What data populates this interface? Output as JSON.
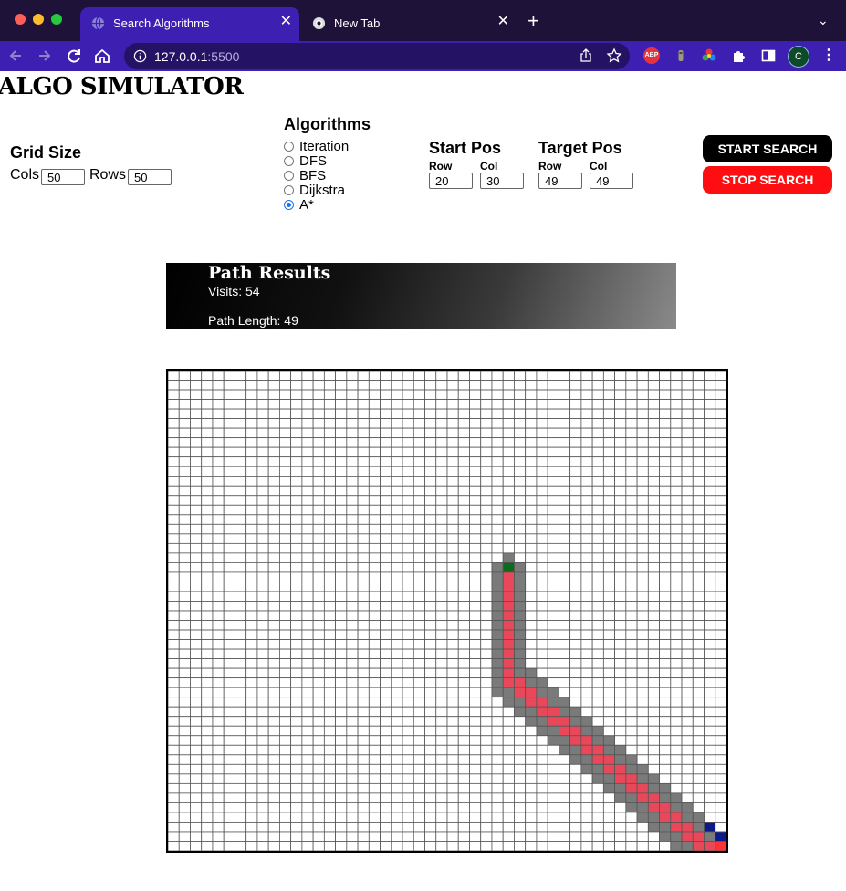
{
  "browser": {
    "tabs": [
      {
        "title": "Search Algorithms",
        "active": true,
        "icon": "globe-icon"
      },
      {
        "title": "New Tab",
        "active": false,
        "icon": "chrome-icon"
      }
    ],
    "close_glyph": "✕",
    "new_tab_glyph": "+",
    "tab_menu_glyph": "⌄",
    "url_host": "127.0.0.1",
    "url_port": ":5500",
    "extension_abp_label": "ABP",
    "profile_initial": "C",
    "menu_glyph": "⋮"
  },
  "page": {
    "title": "ALGO SIMULATOR",
    "grid_size": {
      "heading": "Grid Size",
      "cols_label": "Cols",
      "cols_value": "50",
      "rows_label": "Rows",
      "rows_value": "50"
    },
    "algorithms": {
      "heading": "Algorithms",
      "options": [
        "Iteration",
        "DFS",
        "BFS",
        "Dijkstra",
        "A*"
      ],
      "selected": "A*"
    },
    "start_pos": {
      "heading": "Start Pos",
      "row_label": "Row",
      "row_value": "20",
      "col_label": "Col",
      "col_value": "30"
    },
    "target_pos": {
      "heading": "Target Pos",
      "row_label": "Row",
      "row_value": "49",
      "col_label": "Col",
      "col_value": "49"
    },
    "buttons": {
      "start": "START SEARCH",
      "stop": "STOP SEARCH"
    },
    "results": {
      "heading": "Path Results",
      "visits": "Visits: 54",
      "path_length": "Path Length: 49"
    }
  },
  "grid": {
    "cols": 50,
    "rows": 50,
    "start": {
      "row": 20,
      "col": 30
    },
    "target": {
      "row": 49,
      "col": 49
    },
    "colors": {
      "empty": "#ffffff",
      "line": "#555555",
      "visited": "#7a7a7a",
      "path": "#e8485a",
      "start": "#0b6b1a",
      "frontier": "#0d1a8a",
      "target": "#ff3333"
    }
  }
}
